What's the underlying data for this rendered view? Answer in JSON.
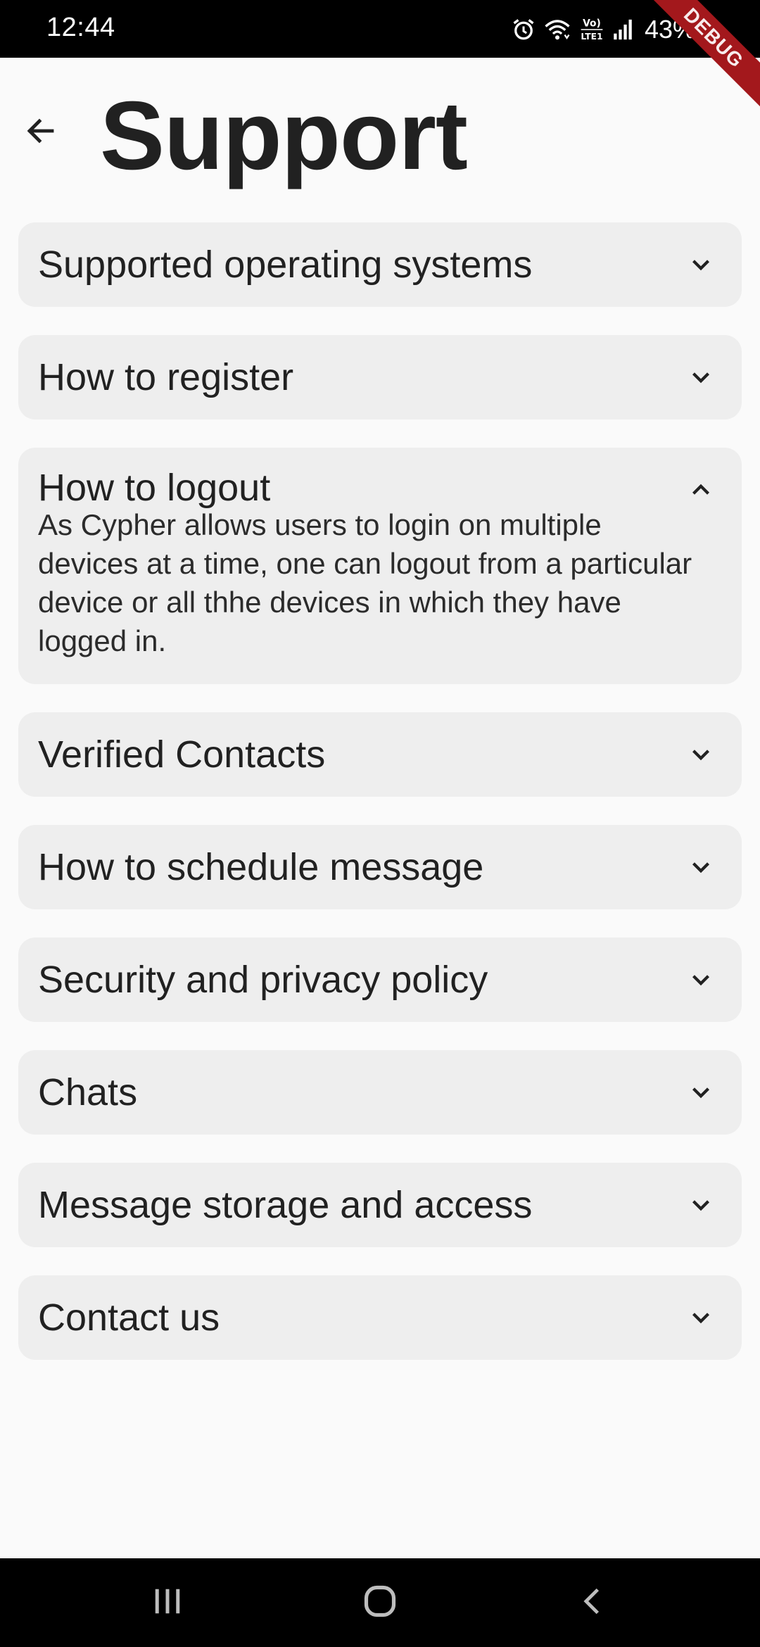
{
  "status_bar": {
    "time": "12:44",
    "battery": "43%",
    "icons": [
      "alarm-icon",
      "wifi-icon",
      "volte-icon",
      "signal-icon"
    ]
  },
  "debug_banner": "DEBUG",
  "header": {
    "back_icon": "arrow-left-icon",
    "title": "Support"
  },
  "faq": [
    {
      "title": "Supported operating systems",
      "expanded": false
    },
    {
      "title": "How to register",
      "expanded": false
    },
    {
      "title": "How to logout",
      "expanded": true,
      "body": "As Cypher allows users to login on multiple devices at a time, one can logout from a particular device or all thhe devices in which they have logged in."
    },
    {
      "title": "Verified Contacts",
      "expanded": false
    },
    {
      "title": "How to schedule message",
      "expanded": false
    },
    {
      "title": "Security and privacy policy",
      "expanded": false
    },
    {
      "title": "Chats",
      "expanded": false
    },
    {
      "title": "Message storage and access",
      "expanded": false
    },
    {
      "title": "Contact us",
      "expanded": false
    }
  ],
  "nav_bar": {
    "buttons": [
      "recent-apps-icon",
      "home-icon",
      "back-icon"
    ]
  },
  "colors": {
    "background": "#fafafa",
    "card": "#eeeeee",
    "text": "#212121",
    "bars": "#000000",
    "debug": "#a3181c"
  }
}
